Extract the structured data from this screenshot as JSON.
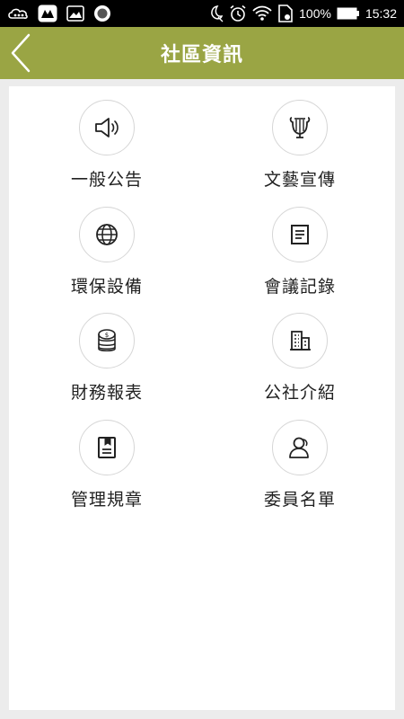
{
  "status_bar": {
    "battery_percent": "100%",
    "time": "15:32"
  },
  "header": {
    "title": "社區資訊"
  },
  "menu": {
    "items": [
      {
        "label": "一般公告",
        "icon": "megaphone-icon"
      },
      {
        "label": "文藝宣傳",
        "icon": "lyre-icon"
      },
      {
        "label": "環保設備",
        "icon": "globe-icon"
      },
      {
        "label": "會議記錄",
        "icon": "document-icon"
      },
      {
        "label": "財務報表",
        "icon": "coins-icon"
      },
      {
        "label": "公社介紹",
        "icon": "building-icon"
      },
      {
        "label": "管理規章",
        "icon": "notebook-icon"
      },
      {
        "label": "委員名單",
        "icon": "person-icon"
      }
    ]
  },
  "colors": {
    "header_bg": "#9aa544",
    "page_bg": "#ececec"
  }
}
